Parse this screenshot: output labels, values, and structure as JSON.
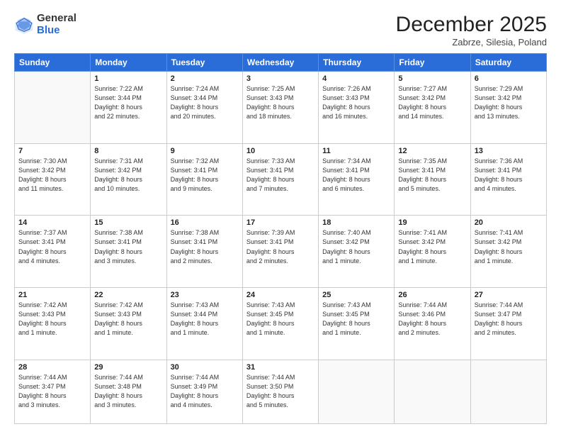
{
  "logo": {
    "general": "General",
    "blue": "Blue"
  },
  "header": {
    "month": "December 2025",
    "location": "Zabrze, Silesia, Poland"
  },
  "weekdays": [
    "Sunday",
    "Monday",
    "Tuesday",
    "Wednesday",
    "Thursday",
    "Friday",
    "Saturday"
  ],
  "weeks": [
    [
      {
        "day": "",
        "info": ""
      },
      {
        "day": "1",
        "info": "Sunrise: 7:22 AM\nSunset: 3:44 PM\nDaylight: 8 hours\nand 22 minutes."
      },
      {
        "day": "2",
        "info": "Sunrise: 7:24 AM\nSunset: 3:44 PM\nDaylight: 8 hours\nand 20 minutes."
      },
      {
        "day": "3",
        "info": "Sunrise: 7:25 AM\nSunset: 3:43 PM\nDaylight: 8 hours\nand 18 minutes."
      },
      {
        "day": "4",
        "info": "Sunrise: 7:26 AM\nSunset: 3:43 PM\nDaylight: 8 hours\nand 16 minutes."
      },
      {
        "day": "5",
        "info": "Sunrise: 7:27 AM\nSunset: 3:42 PM\nDaylight: 8 hours\nand 14 minutes."
      },
      {
        "day": "6",
        "info": "Sunrise: 7:29 AM\nSunset: 3:42 PM\nDaylight: 8 hours\nand 13 minutes."
      }
    ],
    [
      {
        "day": "7",
        "info": "Sunrise: 7:30 AM\nSunset: 3:42 PM\nDaylight: 8 hours\nand 11 minutes."
      },
      {
        "day": "8",
        "info": "Sunrise: 7:31 AM\nSunset: 3:42 PM\nDaylight: 8 hours\nand 10 minutes."
      },
      {
        "day": "9",
        "info": "Sunrise: 7:32 AM\nSunset: 3:41 PM\nDaylight: 8 hours\nand 9 minutes."
      },
      {
        "day": "10",
        "info": "Sunrise: 7:33 AM\nSunset: 3:41 PM\nDaylight: 8 hours\nand 7 minutes."
      },
      {
        "day": "11",
        "info": "Sunrise: 7:34 AM\nSunset: 3:41 PM\nDaylight: 8 hours\nand 6 minutes."
      },
      {
        "day": "12",
        "info": "Sunrise: 7:35 AM\nSunset: 3:41 PM\nDaylight: 8 hours\nand 5 minutes."
      },
      {
        "day": "13",
        "info": "Sunrise: 7:36 AM\nSunset: 3:41 PM\nDaylight: 8 hours\nand 4 minutes."
      }
    ],
    [
      {
        "day": "14",
        "info": "Sunrise: 7:37 AM\nSunset: 3:41 PM\nDaylight: 8 hours\nand 4 minutes."
      },
      {
        "day": "15",
        "info": "Sunrise: 7:38 AM\nSunset: 3:41 PM\nDaylight: 8 hours\nand 3 minutes."
      },
      {
        "day": "16",
        "info": "Sunrise: 7:38 AM\nSunset: 3:41 PM\nDaylight: 8 hours\nand 2 minutes."
      },
      {
        "day": "17",
        "info": "Sunrise: 7:39 AM\nSunset: 3:41 PM\nDaylight: 8 hours\nand 2 minutes."
      },
      {
        "day": "18",
        "info": "Sunrise: 7:40 AM\nSunset: 3:42 PM\nDaylight: 8 hours\nand 1 minute."
      },
      {
        "day": "19",
        "info": "Sunrise: 7:41 AM\nSunset: 3:42 PM\nDaylight: 8 hours\nand 1 minute."
      },
      {
        "day": "20",
        "info": "Sunrise: 7:41 AM\nSunset: 3:42 PM\nDaylight: 8 hours\nand 1 minute."
      }
    ],
    [
      {
        "day": "21",
        "info": "Sunrise: 7:42 AM\nSunset: 3:43 PM\nDaylight: 8 hours\nand 1 minute."
      },
      {
        "day": "22",
        "info": "Sunrise: 7:42 AM\nSunset: 3:43 PM\nDaylight: 8 hours\nand 1 minute."
      },
      {
        "day": "23",
        "info": "Sunrise: 7:43 AM\nSunset: 3:44 PM\nDaylight: 8 hours\nand 1 minute."
      },
      {
        "day": "24",
        "info": "Sunrise: 7:43 AM\nSunset: 3:45 PM\nDaylight: 8 hours\nand 1 minute."
      },
      {
        "day": "25",
        "info": "Sunrise: 7:43 AM\nSunset: 3:45 PM\nDaylight: 8 hours\nand 1 minute."
      },
      {
        "day": "26",
        "info": "Sunrise: 7:44 AM\nSunset: 3:46 PM\nDaylight: 8 hours\nand 2 minutes."
      },
      {
        "day": "27",
        "info": "Sunrise: 7:44 AM\nSunset: 3:47 PM\nDaylight: 8 hours\nand 2 minutes."
      }
    ],
    [
      {
        "day": "28",
        "info": "Sunrise: 7:44 AM\nSunset: 3:47 PM\nDaylight: 8 hours\nand 3 minutes."
      },
      {
        "day": "29",
        "info": "Sunrise: 7:44 AM\nSunset: 3:48 PM\nDaylight: 8 hours\nand 3 minutes."
      },
      {
        "day": "30",
        "info": "Sunrise: 7:44 AM\nSunset: 3:49 PM\nDaylight: 8 hours\nand 4 minutes."
      },
      {
        "day": "31",
        "info": "Sunrise: 7:44 AM\nSunset: 3:50 PM\nDaylight: 8 hours\nand 5 minutes."
      },
      {
        "day": "",
        "info": ""
      },
      {
        "day": "",
        "info": ""
      },
      {
        "day": "",
        "info": ""
      }
    ]
  ]
}
